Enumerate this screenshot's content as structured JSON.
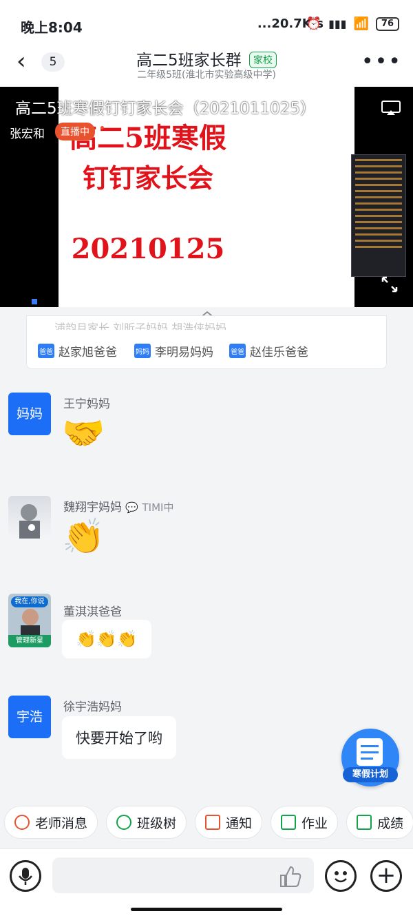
{
  "status": {
    "time": "晚上8:04",
    "speed": "...20.7K/s",
    "battery": "76"
  },
  "header": {
    "back_count": "5",
    "title": "高二5班家长群",
    "tag": "家校",
    "subtitle": "二年级5班(淮北市实验高级中学)"
  },
  "live": {
    "title": "高二5班寒假钉钉家长会（2021011025）",
    "host": "张宏和",
    "status": "直播中",
    "slide_line1": "高二5班寒假",
    "slide_line2": "钉钉家长会",
    "slide_date": "20210125"
  },
  "card": {
    "faded": "浦韵月家长   刘昕子妈妈   胡浩侠妈妈",
    "parents": [
      {
        "tag": "爸爸",
        "name": "赵家旭爸爸"
      },
      {
        "tag": "妈妈",
        "name": "李明易妈妈"
      },
      {
        "tag": "爸爸",
        "name": "赵佳乐爸爸"
      }
    ]
  },
  "messages": [
    {
      "name": "王宁妈妈",
      "avatar": "妈妈",
      "content": "🤝"
    },
    {
      "name": "魏翔宇妈妈",
      "status": "TIMI中",
      "content": "👏"
    },
    {
      "name": "董淇淇爸爸",
      "avatar_badge": "管理新星",
      "avatar_text": "我在,你说",
      "content": "👏👏👏"
    },
    {
      "name": "徐宇浩妈妈",
      "avatar": "宇浩",
      "content": "快要开始了哟"
    }
  ],
  "floating": {
    "label": "寒假计划"
  },
  "quick": [
    {
      "label": "老师消息",
      "icon": "teacher-icon",
      "color": "#e8532f"
    },
    {
      "label": "班级树",
      "icon": "tree-icon",
      "color": "#13a34a"
    },
    {
      "label": "通知",
      "icon": "megaphone-icon",
      "color": "#e8532f"
    },
    {
      "label": "作业",
      "icon": "homework-icon",
      "color": "#13a34a"
    },
    {
      "label": "成绩",
      "icon": "grade-icon",
      "color": "#13a34a"
    }
  ],
  "colors": {
    "accent": "#1b6ef5",
    "live_red": "#e1121a"
  }
}
